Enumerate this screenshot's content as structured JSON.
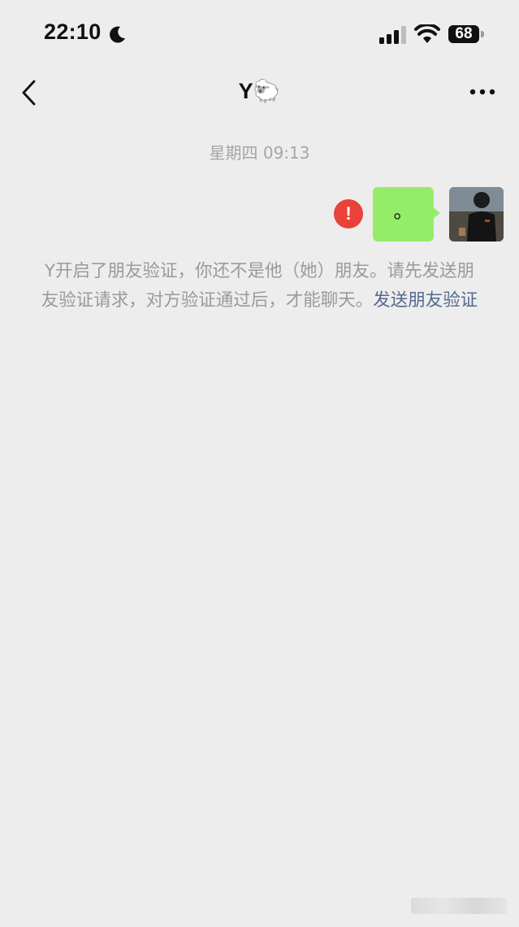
{
  "status_bar": {
    "time": "22:10",
    "battery": "68",
    "icons": [
      "moon-icon",
      "signal-icon",
      "wifi-icon",
      "battery-icon"
    ]
  },
  "nav": {
    "title": "Y🐑",
    "back_icon": "chevron-left-icon",
    "more_icon": "more-icon"
  },
  "chat": {
    "timestamp": "星期四 09:13",
    "message": {
      "text": "。",
      "status": "failed",
      "error_icon": "!"
    },
    "notice": {
      "text": "Y开启了朋友验证，你还不是他（她）朋友。请先发送朋友验证请求，对方验证通过后，才能聊天。",
      "link": "发送朋友验证"
    }
  },
  "colors": {
    "background": "#ededed",
    "bubble": "#95ec69",
    "error": "#e8423a",
    "link": "#56698f"
  }
}
